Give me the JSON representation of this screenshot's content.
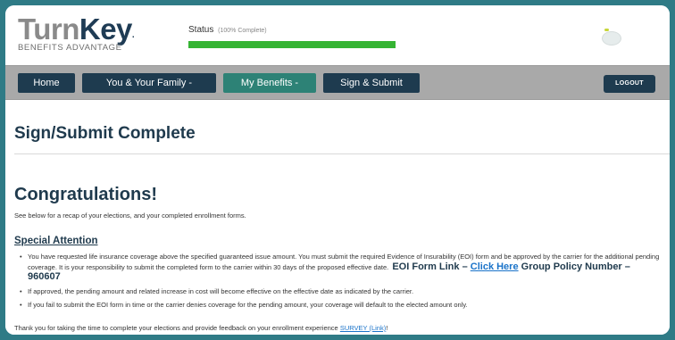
{
  "brand": {
    "name_part1": "Turn",
    "name_part2": "Key",
    "tagline": "BENEFITS ADVANTAGE"
  },
  "status": {
    "label": "Status",
    "percent_text": "(100% Complete)",
    "progress": 1.0,
    "color": "#35b433"
  },
  "nav": {
    "items": [
      {
        "label": "Home"
      },
      {
        "label": "You & Your Family -"
      },
      {
        "label": "My Benefits -"
      },
      {
        "label": "Sign & Submit"
      }
    ],
    "logout_label": "LOGOUT",
    "active_color": "#2d8276",
    "button_color": "#1e3b4f"
  },
  "page": {
    "title": "Sign/Submit Complete",
    "congrats": "Congratulations!",
    "recap": "See below for a recap of your elections, and your completed enrollment forms.",
    "special_heading": "Special Attention",
    "bullet1": "You have requested life insurance coverage above the specified guaranteed issue amount. You must submit the required Evidence of Insurability (EOI) form and be approved by the carrier for the additional pending coverage. It is your responsibility to submit the completed form to the carrier within 30 days of the proposed effective date.",
    "eoi_prefix": "EOI Form Link –",
    "eoi_link": "Click Here",
    "eoi_suffix": "Group Policy Number – 960607",
    "bullet1_after": "If approved, the pending amount and related increase in cost will become effective on the effective date as indicated by the carrier.",
    "bullet2": "If you fail to submit the EOI form in time or the carrier denies coverage for the pending amount, your coverage will default to the elected amount only.",
    "thanks_prefix": "Thank you for taking the time to complete your elections and provide feedback on your enrollment experience",
    "survey_link": "SURVEY (Link)",
    "thanks_suffix": "!"
  }
}
